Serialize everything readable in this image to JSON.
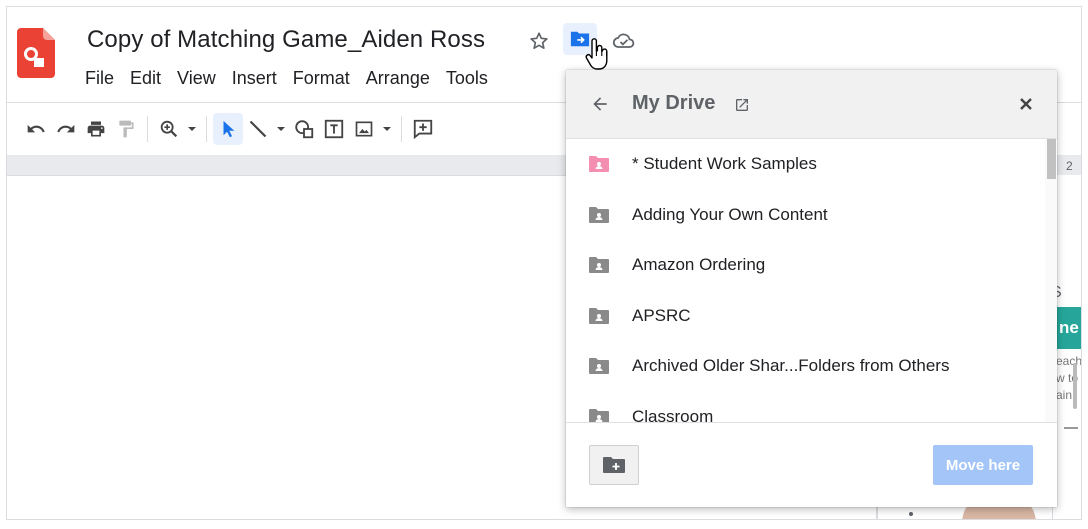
{
  "doc": {
    "title": "Copy of Matching Game_Aiden Ross"
  },
  "menu": [
    "File",
    "Edit",
    "View",
    "Insert",
    "Format",
    "Arrange",
    "Tools"
  ],
  "toolbar": {
    "icons": [
      "undo-icon",
      "redo-icon",
      "print-icon",
      "paint-format-icon",
      "zoom-icon",
      "select-icon",
      "line-icon",
      "shape-icon",
      "textbox-icon",
      "image-icon",
      "comment-icon"
    ]
  },
  "ruler": {
    "peek_number": "2"
  },
  "peek": {
    "letter": "S",
    "banner_text": "ne",
    "lines": [
      "each",
      "w to",
      "ain."
    ]
  },
  "dialog": {
    "title": "My Drive",
    "folders": [
      {
        "label": "* Student Work Samples",
        "color": "#f48fb1"
      },
      {
        "label": "Adding Your Own Content",
        "color": "#8a8a8a"
      },
      {
        "label": "Amazon Ordering",
        "color": "#8a8a8a"
      },
      {
        "label": "APSRC",
        "color": "#8a8a8a"
      },
      {
        "label": "Archived Older Shar...Folders from Others",
        "color": "#8a8a8a"
      },
      {
        "label": "Classroom",
        "color": "#8a8a8a"
      }
    ],
    "move_here_label": "Move here"
  },
  "colors": {
    "accent": "#1a73e8",
    "move_button": "#a3c5f7",
    "logo": "#ea4335"
  }
}
